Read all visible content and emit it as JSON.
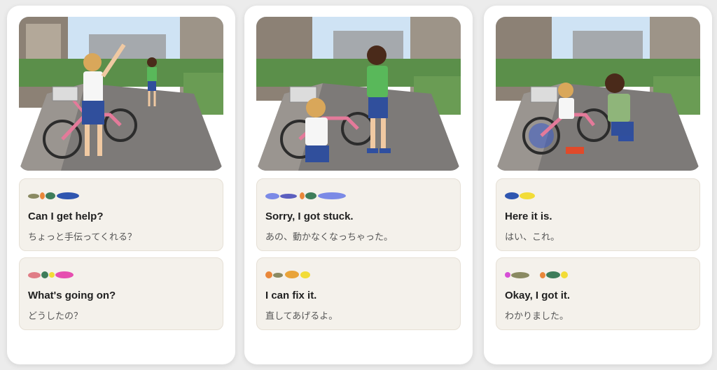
{
  "panels": [
    {
      "image_alt": "Girl with pink bicycle waving to a boy down the street",
      "lines": [
        {
          "en": "Can I get help?",
          "ja": "ちょっと手伝ってくれる？",
          "dots": [
            "#8a8a62",
            "#e9873a",
            "#3e7d5a",
            "#2f56b0"
          ]
        },
        {
          "en": "What's going on?",
          "ja": "どうしたの？",
          "dots": [
            "#e07d86",
            "#3e7d5a",
            "#f2dc37",
            "#e64fb0"
          ]
        }
      ]
    },
    {
      "image_alt": "Boy standing next to the girl with the stuck bicycle",
      "lines": [
        {
          "en": "Sorry, I got stuck.",
          "ja": "あの、動かなくなっちゃった。",
          "dots": [
            "#7b8ae6",
            "#5b5fbf",
            "#e9873a",
            "#3e7d5a",
            "#7b8ae6"
          ]
        },
        {
          "en": "I can fix it.",
          "ja": "直してあげるよ。",
          "dots": [
            "#e9873a",
            "#8a8a62",
            "#e9a43a",
            "#f2dc37"
          ]
        }
      ]
    },
    {
      "image_alt": "Boy kneeling to fix the bicycle chain",
      "lines": [
        {
          "en": "Here it is.",
          "ja": "はい、これ。",
          "dots": [
            "#2f56b0",
            "#f2dc37"
          ]
        },
        {
          "en": "Okay, I got it.",
          "ja": "わかりました。",
          "dots": [
            "#d64fd6",
            "#8a8a62",
            "#e9873a",
            "#3e7d5a",
            "#f2dc37"
          ]
        }
      ]
    }
  ]
}
